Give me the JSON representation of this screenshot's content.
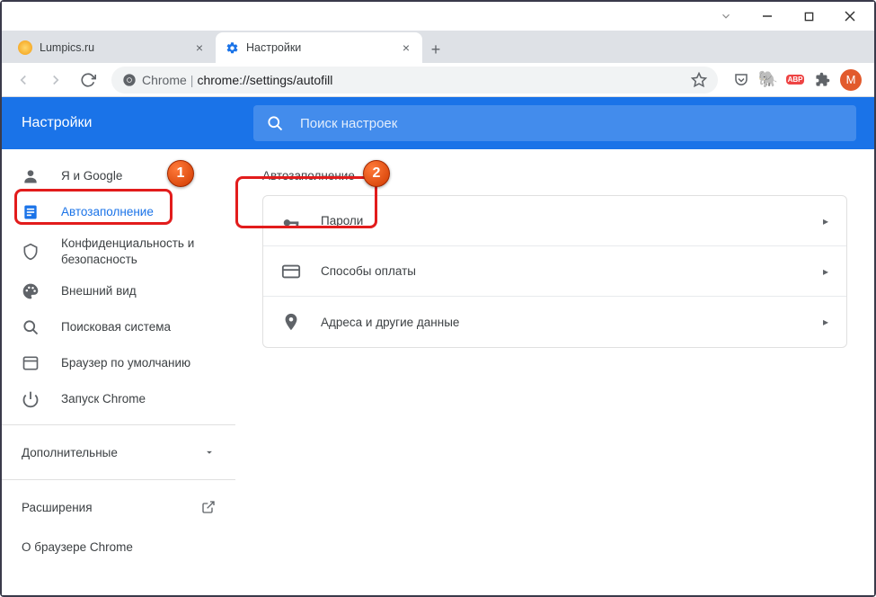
{
  "window": {
    "minimize": "—",
    "maximize": "□",
    "close": "✕"
  },
  "tabs": [
    {
      "title": "Lumpics.ru",
      "favicon_color": "#f39c12",
      "active": false
    },
    {
      "title": "Настройки",
      "favicon_color": "#1a73e8",
      "active": true
    }
  ],
  "toolbar": {
    "chrome_label": "Chrome",
    "url_path": "chrome://settings/autofill",
    "profile_letter": "M"
  },
  "sidebar": {
    "title": "Настройки",
    "items": [
      {
        "label": "Я и Google",
        "icon": "person"
      },
      {
        "label": "Автозаполнение",
        "icon": "autofill",
        "active": true
      },
      {
        "label": "Конфиденциальность и безопасность",
        "icon": "shield"
      },
      {
        "label": "Внешний вид",
        "icon": "palette"
      },
      {
        "label": "Поисковая система",
        "icon": "search"
      },
      {
        "label": "Браузер по умолчанию",
        "icon": "browser"
      },
      {
        "label": "Запуск Chrome",
        "icon": "power"
      }
    ],
    "advanced": "Дополнительные",
    "extensions": "Расширения",
    "about": "О браузере Chrome"
  },
  "main": {
    "search_placeholder": "Поиск настроек",
    "section_title": "Автозаполнение",
    "rows": [
      {
        "label": "Пароли",
        "icon": "key"
      },
      {
        "label": "Способы оплаты",
        "icon": "card"
      },
      {
        "label": "Адреса и другие данные",
        "icon": "location"
      }
    ]
  },
  "callouts": {
    "one": "1",
    "two": "2"
  }
}
